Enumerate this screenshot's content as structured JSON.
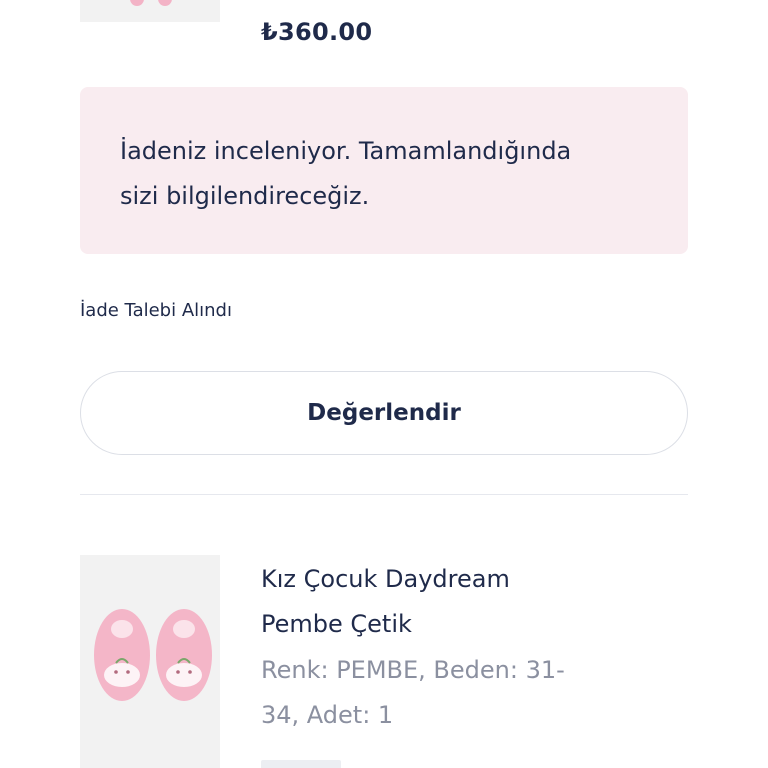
{
  "previous_item": {
    "price": "₺360.00",
    "image_icon": "pink-sock-icon"
  },
  "return_notice": {
    "line1": "İadeniz inceleniyor. Tamamlandığında",
    "line2": "sizi bilgilendireceğiz."
  },
  "return_status": "İade Talebi Alındı",
  "rate_button_label": "Değerlendir",
  "product": {
    "name_line1": "Kız Çocuk Daydream",
    "name_line2": "Pembe Çetik",
    "meta_line1": "Renk: PEMBE, Beden: 31-",
    "meta_line2": "34, Adet: 1",
    "image_icon": "pink-slippers-icon"
  },
  "colors": {
    "primary_text": "#1f2a4a",
    "muted_text": "#8b90a0",
    "notice_bg": "#f9ecf0",
    "thumb_bg": "#f2f2f2",
    "slipper_pink": "#f4b6c8"
  }
}
